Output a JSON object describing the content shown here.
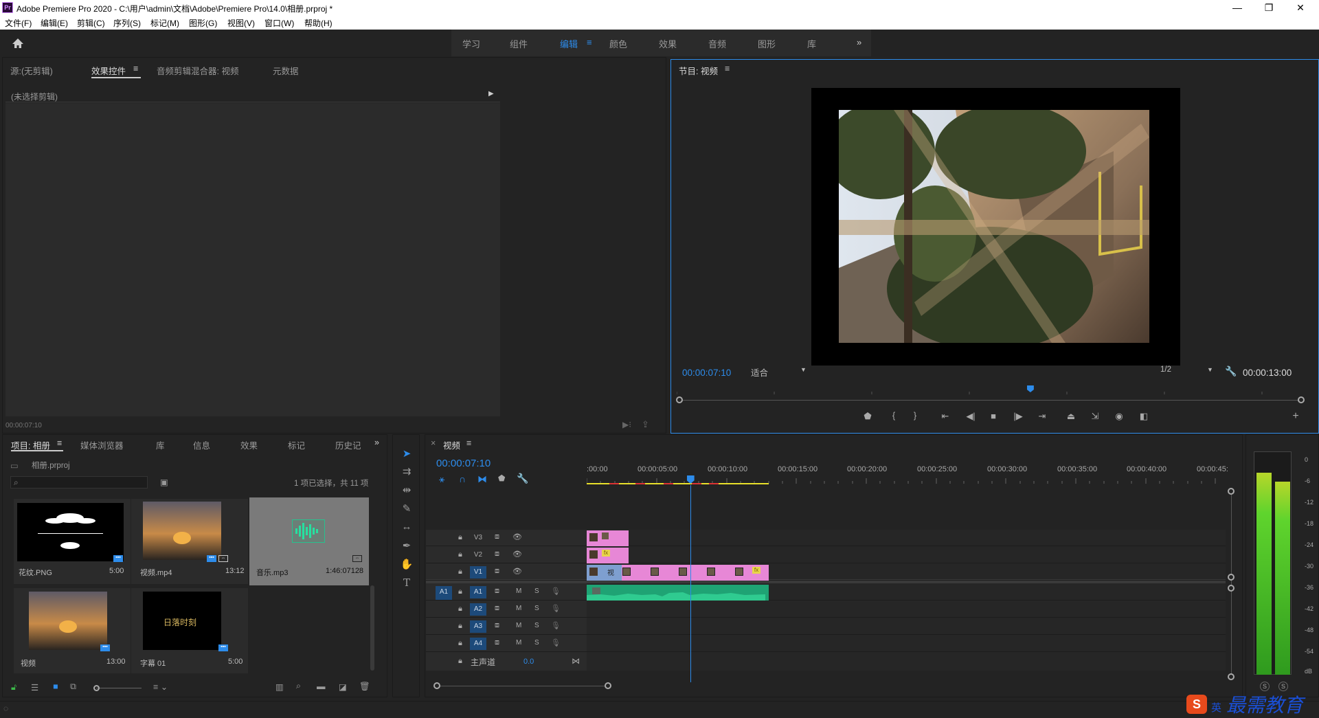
{
  "app": {
    "icon_text": "Pr",
    "title": "Adobe Premiere Pro 2020 - C:\\用户\\admin\\文档\\Adobe\\Premiere Pro\\14.0\\相册.prproj *",
    "minimize": "—",
    "maximize": "❐",
    "close": "✕"
  },
  "menu": [
    "文件(F)",
    "编辑(E)",
    "剪辑(C)",
    "序列(S)",
    "标记(M)",
    "图形(G)",
    "视图(V)",
    "窗口(W)",
    "帮助(H)"
  ],
  "workspaces": {
    "items": [
      "学习",
      "组件",
      "编辑",
      "颜色",
      "效果",
      "音频",
      "图形",
      "库"
    ],
    "active": "编辑",
    "overflow": "»"
  },
  "source_panel": {
    "tabs": [
      "源:(无剪辑)",
      "效果控件",
      "音频剪辑混合器: 视频",
      "元数据"
    ],
    "active_tab": "效果控件",
    "no_clip": "(未选择剪辑)",
    "timecode": "00:00:07:10"
  },
  "program_monitor": {
    "title": "节目: 视频",
    "timecode": "00:00:07:10",
    "zoom": "适合",
    "resolution": "1/2",
    "duration": "00:00:13:00",
    "playhead_fraction": 0.565
  },
  "project_panel": {
    "tabs": [
      "项目: 相册",
      "媒体浏览器",
      "库",
      "信息",
      "效果",
      "标记",
      "历史记"
    ],
    "active_tab": "项目: 相册",
    "overflow": "»",
    "file": "相册.prproj",
    "search_placeholder": "",
    "selection_info": "1 项已选择，共 11 项",
    "items": [
      {
        "name": "花纹.PNG",
        "duration": "5:00"
      },
      {
        "name": "视频.mp4",
        "duration": "13:12"
      },
      {
        "name": "音乐.mp3",
        "duration": "1:46:07128"
      },
      {
        "name": "视频",
        "duration": "13:00"
      },
      {
        "name": "字幕 01",
        "duration": "5:00"
      }
    ],
    "subtitle_thumb_text": "日落时刻"
  },
  "timeline": {
    "tab": "视频",
    "timecode": "00:00:07:10",
    "ruler": [
      ":00:00",
      "00:00:05:00",
      "00:00:10:00",
      "00:00:15:00",
      "00:00:20:00",
      "00:00:25:00",
      "00:00:30:00",
      "00:00:35:00",
      "00:00:40:00",
      "00:00:45:"
    ],
    "video_tracks": [
      "V3",
      "V2",
      "V1"
    ],
    "audio_tracks": [
      "A1",
      "A2",
      "A3",
      "A4"
    ],
    "source_patch": "A1",
    "mute": "M",
    "solo": "S",
    "master": "主声道",
    "master_level": "0.0",
    "v1_clip_label": "视",
    "fx_label": "fx",
    "sequence_length_seconds": 13,
    "playhead_seconds": 7.4
  },
  "meters": {
    "scale": [
      "0",
      "-6",
      "-12",
      "-18",
      "-24",
      "-30",
      "-36",
      "-42",
      "-48",
      "-54",
      "dB"
    ],
    "left_level_db": -4.5,
    "right_level_db": -7,
    "solo_left": "S",
    "solo_right": "S"
  },
  "colors": {
    "accent": "#2d8ceb",
    "video_clip": "#e787d6",
    "audio_clip": "#1fa374",
    "sequence_clip": "#7e9fd0",
    "meter_green": "#5fd42d"
  },
  "watermark": {
    "text": "最需教育",
    "ime": "英"
  }
}
